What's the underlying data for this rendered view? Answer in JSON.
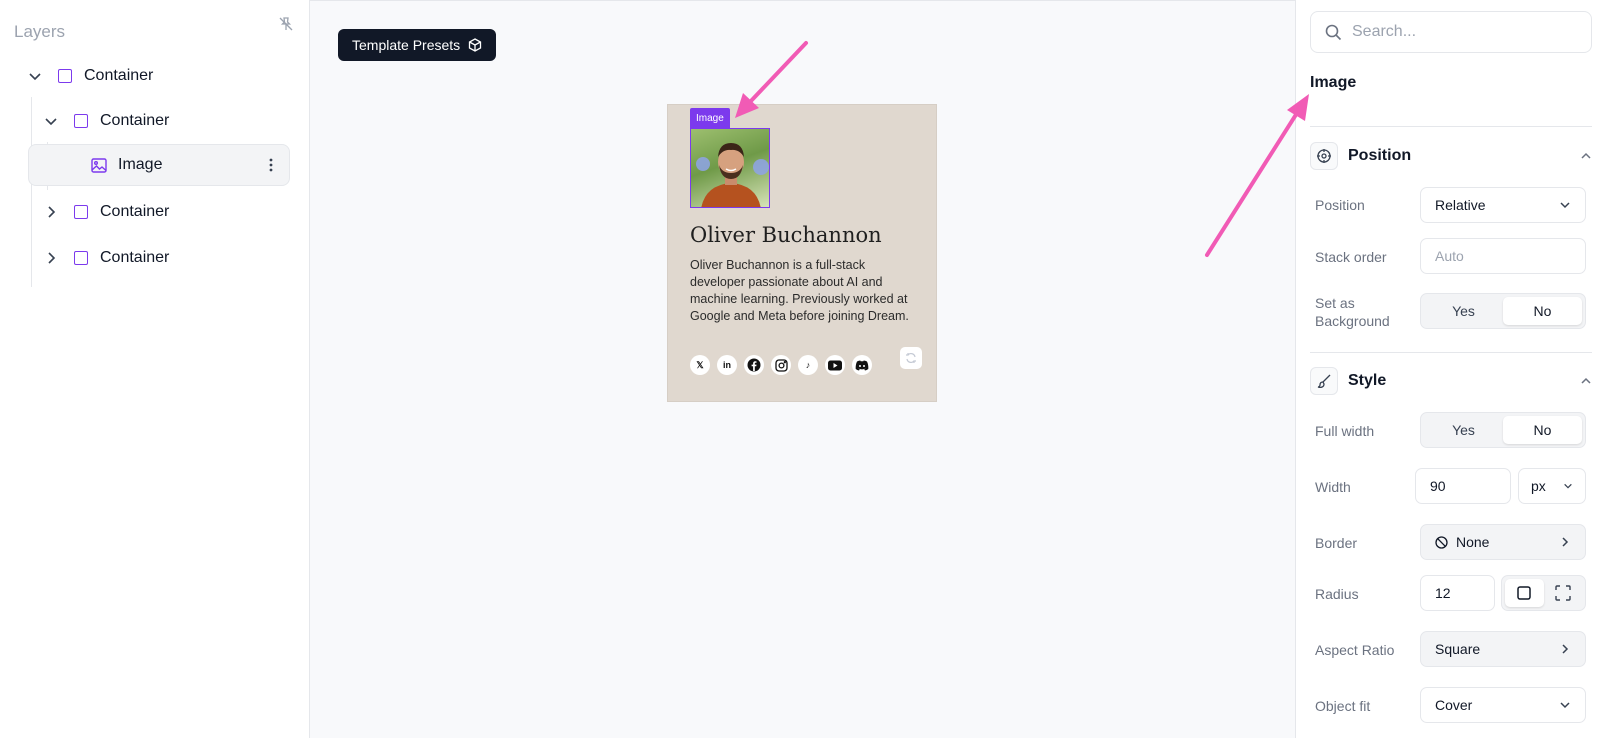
{
  "layers_panel": {
    "title": "Layers",
    "items": [
      {
        "label": "Container",
        "expanded": true
      },
      {
        "label": "Container",
        "expanded": true
      },
      {
        "label": "Image",
        "selected": true
      },
      {
        "label": "Container",
        "expanded": false
      },
      {
        "label": "Container",
        "expanded": false
      }
    ]
  },
  "canvas": {
    "template_presets_label": "Template Presets",
    "image_tag": "Image",
    "card": {
      "name": "Oliver Buchannon",
      "bio": "Oliver Buchannon is a full-stack developer passionate about AI and machine learning. Previously worked at Google and Meta before joining Dream.",
      "socials": [
        "x-icon",
        "linkedin-icon",
        "facebook-icon",
        "instagram-icon",
        "tiktok-icon",
        "youtube-icon",
        "discord-icon"
      ]
    }
  },
  "inspector": {
    "search_placeholder": "Search...",
    "selected_element": "Image",
    "position_section": {
      "title": "Position",
      "position_label": "Position",
      "position_value": "Relative",
      "stack_order_label": "Stack order",
      "stack_order_placeholder": "Auto",
      "set_background_label": "Set as Background",
      "yes": "Yes",
      "no": "No"
    },
    "style_section": {
      "title": "Style",
      "full_width_label": "Full width",
      "yes": "Yes",
      "no": "No",
      "width_label": "Width",
      "width_value": "90",
      "width_unit": "px",
      "border_label": "Border",
      "border_value": "None",
      "radius_label": "Radius",
      "radius_value": "12",
      "aspect_ratio_label": "Aspect Ratio",
      "aspect_ratio_value": "Square",
      "object_fit_label": "Object fit",
      "object_fit_value": "Cover"
    }
  },
  "colors": {
    "accent": "#7c3aed",
    "annotation_arrow": "#f15bb5",
    "card_bg": "#e0d8cf",
    "dark_button": "#111827"
  }
}
